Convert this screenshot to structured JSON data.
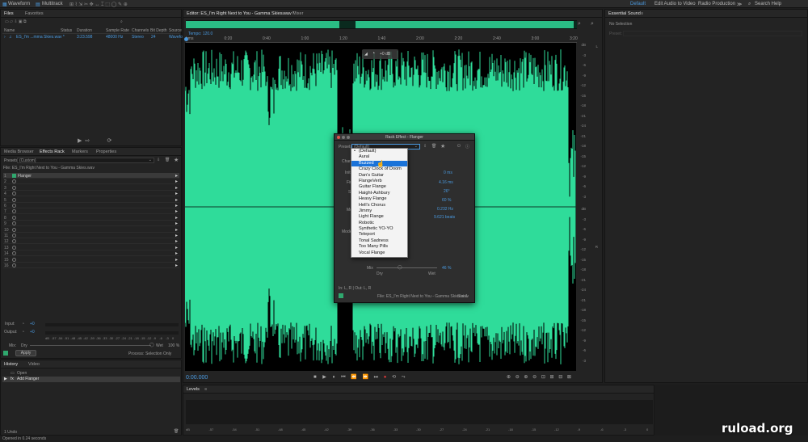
{
  "topbar": {
    "waveform": "Waveform",
    "multitrack": "Multitrack",
    "workspace_default": "Default",
    "workspace_edit_video": "Edit Audio to Video",
    "workspace_radio": "Radio Production",
    "search_placeholder": "Search Help"
  },
  "files_panel": {
    "tabs": [
      "Files",
      "Favorites"
    ],
    "columns": [
      "Name",
      "Status",
      "Duration",
      "Sample Rate",
      "Channels",
      "Bit Depth",
      "Source"
    ],
    "row": {
      "name": "ES_I'm ...mma Skies.wav *",
      "duration": "3:23.598",
      "sample_rate": "48000 Hz",
      "channels": "Stereo",
      "bit_depth": "24",
      "source": "Wavefo"
    }
  },
  "effects_panel": {
    "tabs": [
      "Media Browser",
      "Effects Rack",
      "Markers",
      "Properties"
    ],
    "presets_label": "Presets:",
    "presets_value": "(Custom)",
    "file_label": "File: ES_I'm Right Next to You - Gamma Skies.wav",
    "slots": [
      "1",
      "2",
      "3",
      "4",
      "5",
      "6",
      "7",
      "8",
      "9",
      "10",
      "11",
      "12",
      "13",
      "14",
      "15",
      "16"
    ],
    "slot1_effect": "Flanger",
    "input_label": "Input:",
    "output_label": "Output:",
    "input_value": "+0",
    "output_value": "+0",
    "level_ticks": [
      "dB",
      "-57",
      "-54",
      "-51",
      "-48",
      "-45",
      "-42",
      "-39",
      "-36",
      "-33",
      "-30",
      "-27",
      "-24",
      "-21",
      "-18",
      "-15",
      "-12",
      "-9",
      "-6",
      "-3",
      "0"
    ],
    "mix_label": "Mix:",
    "dry_label": "Dry",
    "wet_label": "Wet",
    "mix_value": "100 %",
    "apply_label": "Apply",
    "process_label": "Process:",
    "process_value": "Selection Only"
  },
  "history_panel": {
    "tabs": [
      "History",
      "Video"
    ],
    "items": [
      "Open",
      "Add Flanger"
    ],
    "undo": "1 Undo",
    "status": "Opened in 0.24 seconds"
  },
  "editor": {
    "tabs": [
      "Editor: ES_I'm Right Next to You - Gamma Skies.wav *",
      "Mixer"
    ],
    "tempo": "Tempo: 120.0",
    "ruler": [
      "hms",
      "0:20",
      "0:40",
      "1:00",
      "1:20",
      "1:40",
      "2:00",
      "2:20",
      "2:40",
      "3:00",
      "3:20"
    ],
    "hud_value": "+0 dB",
    "timecode": "0:00.000",
    "db_scale_top": [
      "dB",
      "-3",
      "-6",
      "-9",
      "-12",
      "-15",
      "-18",
      "-21",
      "-24",
      "-21",
      "-18",
      "-15",
      "-12",
      "-9",
      "-6",
      "-3"
    ],
    "db_scale_bottom": [
      "dB",
      "-3",
      "-6",
      "-9",
      "-12",
      "-15",
      "-18",
      "-21",
      "-24",
      "-21",
      "-18",
      "-15",
      "-12",
      "-9",
      "-6",
      "-3"
    ],
    "wave_color": "#2fdc9a"
  },
  "levels_panel": {
    "title": "Levels",
    "ticks": [
      "dB",
      "-57",
      "-54",
      "-51",
      "-48",
      "-45",
      "-42",
      "-39",
      "-36",
      "-33",
      "-30",
      "-27",
      "-24",
      "-21",
      "-18",
      "-15",
      "-12",
      "-9",
      "-6",
      "-3",
      "0"
    ]
  },
  "essential_sound": {
    "title": "Essential Sound",
    "status": "No Selection",
    "preset_label": "Preset:"
  },
  "rack_dialog": {
    "title": "Rack Effect - Flanger",
    "presets_label": "Presets:",
    "presets_value": "(Default)",
    "param_labels": [
      "Chara",
      "Initia",
      "Fin",
      "St",
      "Mo",
      "Mode"
    ],
    "values": [
      "0 ms",
      "4.16 ms",
      "26°",
      "60 %",
      "0.232 Hz",
      "9.621 beats"
    ],
    "mix_label": "Mix",
    "mix_value": "46 %",
    "dry": "Dry",
    "wet": "Wet",
    "io": "In: L, R | Out: L, R",
    "file": "File: ES_I'm Right Next to You - Gamma Skies.wav",
    "slot": "Slot 1"
  },
  "preset_dropdown": {
    "items": [
      "(Default)",
      "Aural",
      "Buzzed",
      "Crazy Clock of Doom",
      "Dan's Guitar",
      "FlangeVerb",
      "Guitar Flange",
      "Haight-Ashbury",
      "Heavy Flange",
      "Hell's Chorus",
      "Jimmy",
      "Light Flange",
      "Robotic",
      "Synthetic YO-YO",
      "Teleport",
      "Tonal Sadness",
      "Too Many Pills",
      "Vocal Flange"
    ],
    "checked": "(Default)",
    "highlighted": "Buzzed"
  },
  "watermark": "ruload.org",
  "colors": {
    "accent": "#4a9ae0",
    "wave": "#2fdc9a",
    "highlight": "#1a73d9"
  }
}
